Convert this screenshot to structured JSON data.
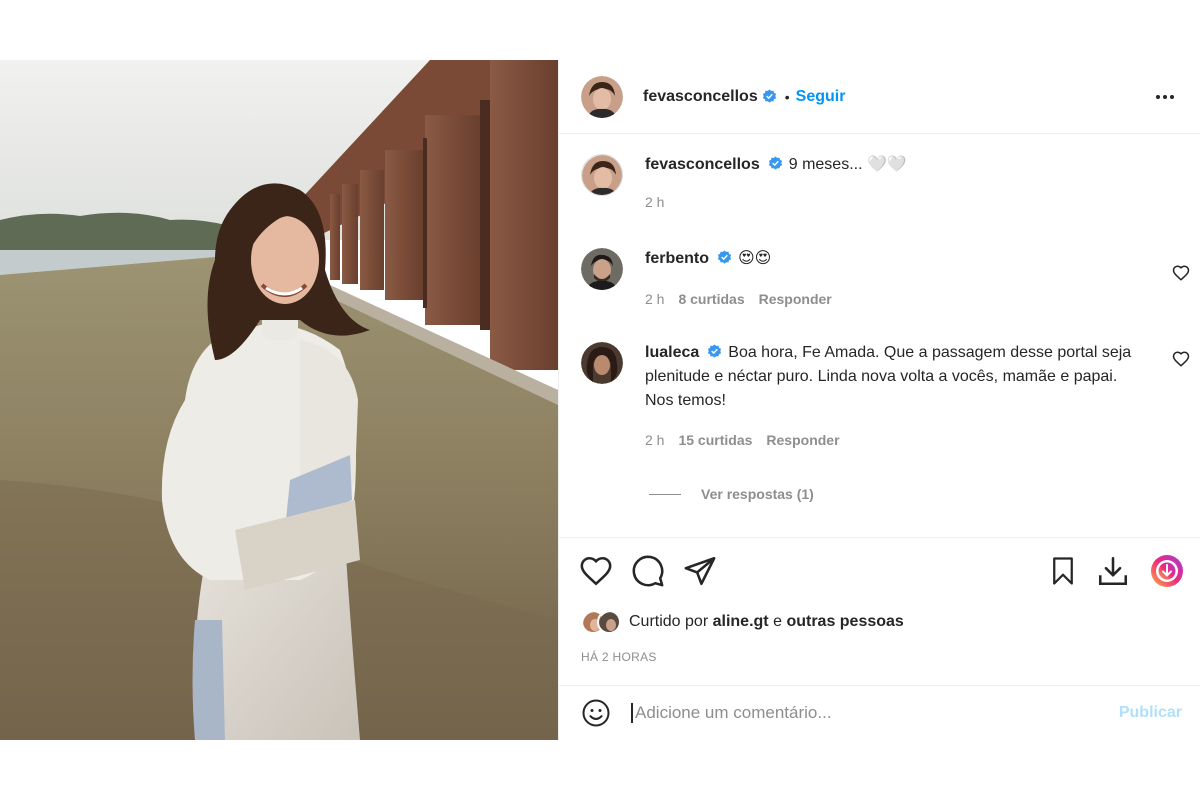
{
  "post": {
    "author": "fevasconcellos",
    "follow_label": "Seguir",
    "separator": "•",
    "more_icon": "more-horizontal-icon"
  },
  "caption": {
    "username": "fevasconcellos",
    "text": "9 meses... 🤍🤍",
    "time": "2 h"
  },
  "comments": [
    {
      "username": "ferbento",
      "text": "😍😍",
      "time": "2 h",
      "likes": "8 curtidas",
      "reply": "Responder"
    },
    {
      "username": "lualeca",
      "text": "Boa hora, Fe Amada. Que a passagem desse portal seja plenitude e néctar puro. Linda nova volta a vocês, mamãe e papai. Nos temos!",
      "time": "2 h",
      "likes": "15 curtidas",
      "reply": "Responder"
    }
  ],
  "view_replies": "Ver respostas (1)",
  "likes": {
    "prefix": "Curtido por",
    "user": "aline.gt",
    "conj": "e",
    "others": "outras pessoas"
  },
  "timestamp": "HÁ 2 HORAS",
  "add_comment": {
    "placeholder": "Adicione um comentário...",
    "publish": "Publicar"
  },
  "colors": {
    "accent": "#0095f6",
    "verified": "#3897f0",
    "muted": "#8e8e8e",
    "publish_disabled": "#b2dffc"
  }
}
